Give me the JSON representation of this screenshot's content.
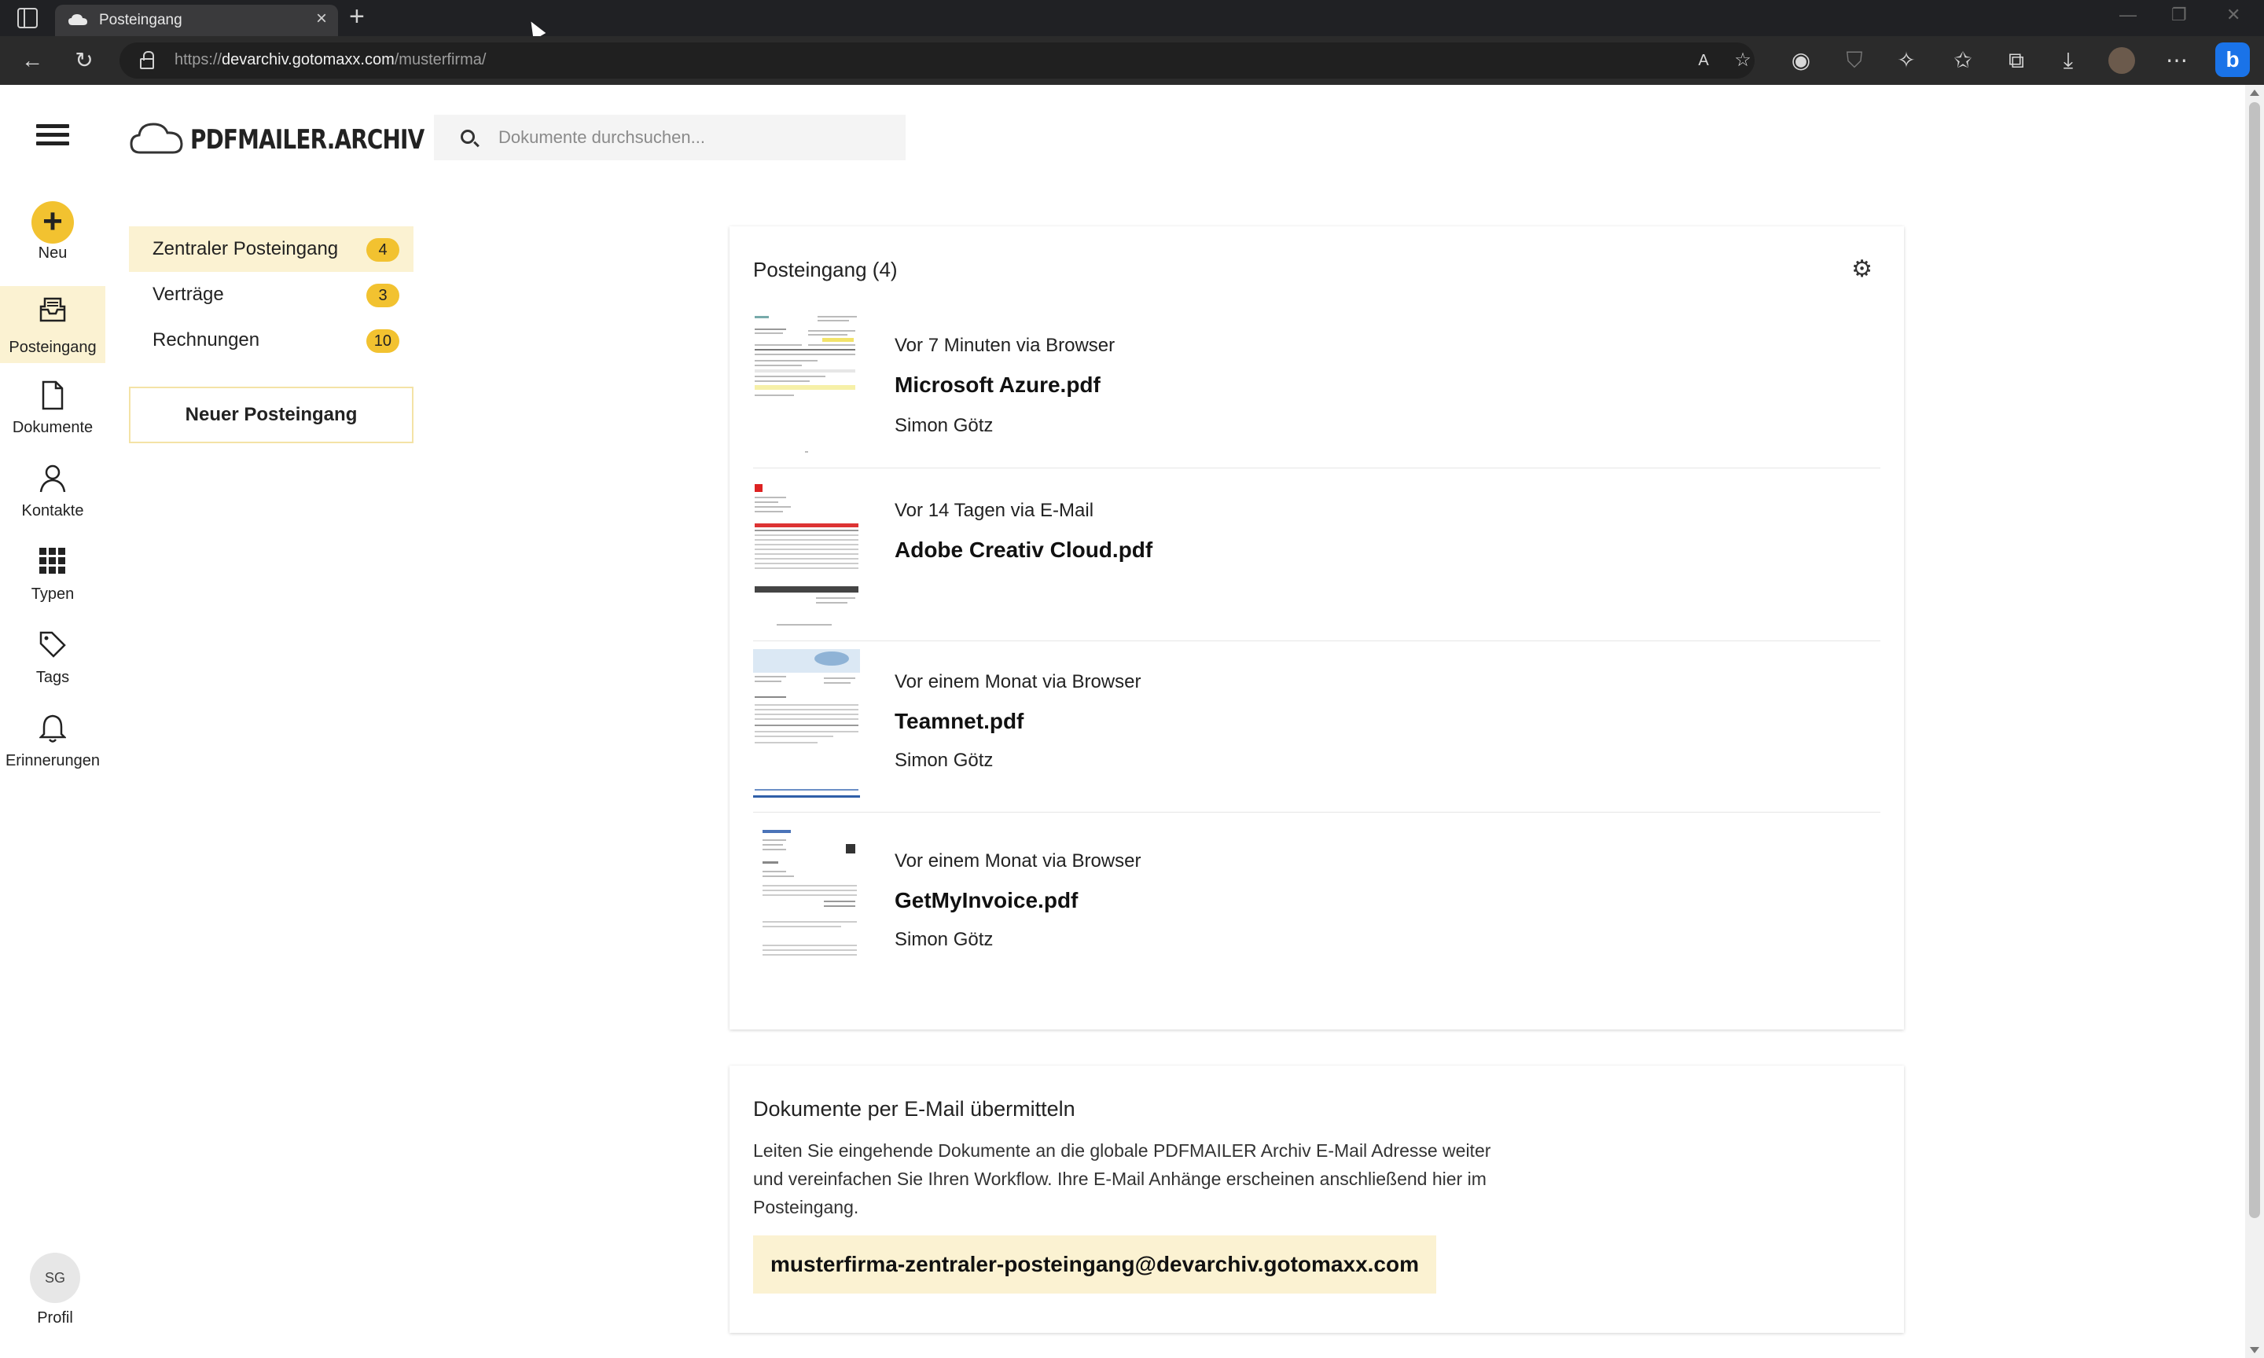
{
  "browser": {
    "tab_title": "Posteingang",
    "url_scheme_host_prefix": "https://",
    "url_host": "devarchiv.gotomaxx.com",
    "url_path": "/musterfirma/"
  },
  "app": {
    "logo_text": "PDFMAILER.ARCHIV",
    "search_placeholder": "Dokumente durchsuchen...",
    "accent_color": "#f2c230",
    "highlight_color": "#fbf2d2"
  },
  "rail": {
    "neu": "Neu",
    "posteingang": "Posteingang",
    "dokumente": "Dokumente",
    "kontakte": "Kontakte",
    "typen": "Typen",
    "tags": "Tags",
    "erinnerungen": "Erinnerungen",
    "profile_initials": "SG",
    "profile_label": "Profil"
  },
  "inboxes": [
    {
      "label": "Zentraler Posteingang",
      "count": "4",
      "active": true
    },
    {
      "label": "Verträge",
      "count": "3",
      "active": false
    },
    {
      "label": "Rechnungen",
      "count": "10",
      "active": false
    }
  ],
  "new_inbox_label": "Neuer Posteingang",
  "inbox_card": {
    "title": "Posteingang (4)",
    "documents": [
      {
        "meta": "Vor 7 Minuten via Browser",
        "name": "Microsoft Azure.pdf",
        "user": "Simon Götz"
      },
      {
        "meta": "Vor 14 Tagen via E-Mail",
        "name": "Adobe Creativ Cloud.pdf",
        "user": ""
      },
      {
        "meta": "Vor einem Monat via Browser",
        "name": "Teamnet.pdf",
        "user": "Simon Götz"
      },
      {
        "meta": "Vor einem Monat via Browser",
        "name": "GetMyInvoice.pdf",
        "user": "Simon Götz"
      }
    ]
  },
  "mail_card": {
    "title": "Dokumente per E-Mail übermitteln",
    "text": "Leiten Sie eingehende Dokumente an die globale PDFMAILER Archiv E-Mail Adresse weiter und vereinfachen Sie Ihren Workflow. Ihre E-Mail Anhänge erscheinen anschließend hier im Posteingang.",
    "address": "musterfirma-zentraler-posteingang@devarchiv.gotomaxx.com"
  }
}
